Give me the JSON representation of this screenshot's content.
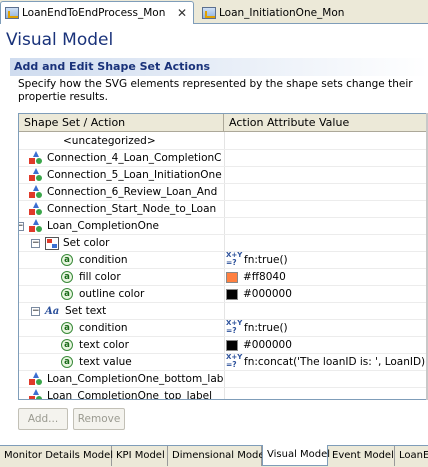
{
  "editor_tabs": [
    {
      "label": "LoanEndToEndProcess_Mon",
      "icon": "monitor-model-icon",
      "closable": true,
      "active": true
    },
    {
      "label": "Loan_InitiationOne_Mon",
      "icon": "monitor-model-icon",
      "closable": false,
      "active": false
    }
  ],
  "page_title": "Visual Model",
  "section": {
    "title": "Add and Edit Shape Set Actions",
    "description": "Specify how the SVG elements represented by the shape sets change their propertie results."
  },
  "table": {
    "columns": [
      "Shape Set / Action",
      "Action Attribute Value"
    ],
    "rows": [
      {
        "indent": 0,
        "icon": "",
        "label": "<uncategorized>",
        "value": "",
        "value_icon": "",
        "swatch": ""
      },
      {
        "indent": 0,
        "icon": "shape-set-icon",
        "label": "Connection_4_Loan_CompletionC",
        "value": "",
        "value_icon": "",
        "swatch": ""
      },
      {
        "indent": 0,
        "icon": "shape-set-icon",
        "label": "Connection_5_Loan_InitiationOne",
        "value": "",
        "value_icon": "",
        "swatch": ""
      },
      {
        "indent": 0,
        "icon": "shape-set-icon",
        "label": "Connection_6_Review_Loan_And",
        "value": "",
        "value_icon": "",
        "swatch": ""
      },
      {
        "indent": 0,
        "icon": "shape-set-icon",
        "label": "Connection_Start_Node_to_Loan",
        "value": "",
        "value_icon": "",
        "swatch": ""
      },
      {
        "indent": 0,
        "expander": "−",
        "icon": "shape-set-icon",
        "label": "Loan_CompletionOne",
        "value": "",
        "value_icon": "",
        "swatch": ""
      },
      {
        "indent": 1,
        "expander": "−",
        "icon": "set-color-icon",
        "label": "Set color",
        "value": "",
        "value_icon": "",
        "swatch": ""
      },
      {
        "indent": 2,
        "icon": "attribute-icon",
        "label": "condition",
        "value": "fn:true()",
        "value_icon": "xpath-icon",
        "swatch": ""
      },
      {
        "indent": 2,
        "icon": "attribute-icon",
        "label": "fill color",
        "value": "#ff8040",
        "value_icon": "",
        "swatch": "#ff8040"
      },
      {
        "indent": 2,
        "icon": "attribute-icon",
        "label": "outline color",
        "value": "#000000",
        "value_icon": "",
        "swatch": "#000000"
      },
      {
        "indent": 1,
        "expander": "−",
        "icon": "set-text-icon",
        "label": "Set text",
        "value": "",
        "value_icon": "",
        "swatch": ""
      },
      {
        "indent": 2,
        "icon": "attribute-icon",
        "label": "condition",
        "value": "fn:true()",
        "value_icon": "xpath-icon",
        "swatch": ""
      },
      {
        "indent": 2,
        "icon": "attribute-icon",
        "label": "text color",
        "value": "#000000",
        "value_icon": "",
        "swatch": "#000000"
      },
      {
        "indent": 2,
        "icon": "attribute-icon",
        "label": "text value",
        "value": "fn:concat('The loanID is: ', LoanID)",
        "value_icon": "xpath-icon",
        "swatch": ""
      },
      {
        "indent": 0,
        "icon": "shape-set-icon",
        "label": "Loan_CompletionOne_bottom_lab",
        "value": "",
        "value_icon": "",
        "swatch": ""
      },
      {
        "indent": 0,
        "icon": "shape-set-icon",
        "label": "Loan_CompletionOne_top_label",
        "value": "",
        "value_icon": "",
        "swatch": ""
      }
    ]
  },
  "icon_text": {
    "set_text": "Aa",
    "attribute": "a",
    "xpath_top": "X+Y",
    "xpath_bottom": "=?"
  },
  "buttons": {
    "add": "Add...",
    "remove": "Remove"
  },
  "page_tabs": [
    {
      "label": "Monitor Details Model",
      "active": false
    },
    {
      "label": "KPI Model",
      "active": false
    },
    {
      "label": "Dimensional Model",
      "active": false
    },
    {
      "label": "Visual Model",
      "active": true
    },
    {
      "label": "Event Model",
      "active": false
    },
    {
      "label": "LoanEnd",
      "active": false
    }
  ],
  "colors": {
    "title": "#19327a",
    "accent_border": "#7f9db9",
    "fill_swatch": "#ff8040"
  }
}
